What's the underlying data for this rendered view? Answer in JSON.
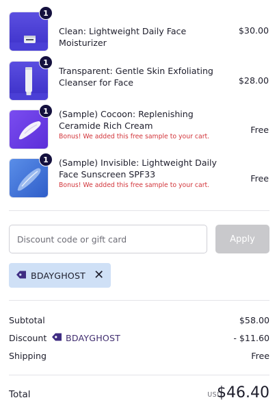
{
  "cart": {
    "items": [
      {
        "qty": "1",
        "name": "Clean: Lightweight Daily Face Moisturizer",
        "bonus": "",
        "price": "$30.00",
        "thumb_icon": "moisturizer-jar-icon"
      },
      {
        "qty": "1",
        "name": "Transparent: Gentle Skin Exfoliating Cleanser for Face",
        "bonus": "",
        "price": "$28.00",
        "thumb_icon": "cleanser-tube-icon"
      },
      {
        "qty": "1",
        "name": "(Sample) Cocoon: Replenishing Ceramide Rich Cream",
        "bonus": "Bonus! We added this free sample to your cart.",
        "price": "Free",
        "thumb_icon": "cream-swatch-icon"
      },
      {
        "qty": "1",
        "name": "(Sample) Invisible: Lightweight Daily Face Sunscreen SPF33",
        "bonus": "Bonus! We added this free sample to your cart.",
        "price": "Free",
        "thumb_icon": "sunscreen-swatch-icon"
      }
    ]
  },
  "discount": {
    "placeholder": "Discount code or gift card",
    "value": "",
    "apply_label": "Apply",
    "applied_code": "BDAYGHOST",
    "remove_icon": "close-icon",
    "tag_icon": "tag-icon"
  },
  "summary": {
    "subtotal_label": "Subtotal",
    "subtotal_value": "$58.00",
    "discount_label": "Discount",
    "discount_code": "BDAYGHOST",
    "discount_value": "- $11.60",
    "shipping_label": "Shipping",
    "shipping_value": "Free",
    "total_label": "Total",
    "currency": "USD",
    "total_value": "$46.40"
  },
  "colors": {
    "badge": "#14103e",
    "bonus_text": "#d2353b",
    "chip_bg": "#cfe0f6",
    "apply_disabled": "#c9c9cc",
    "tag": "#3f2c82"
  }
}
